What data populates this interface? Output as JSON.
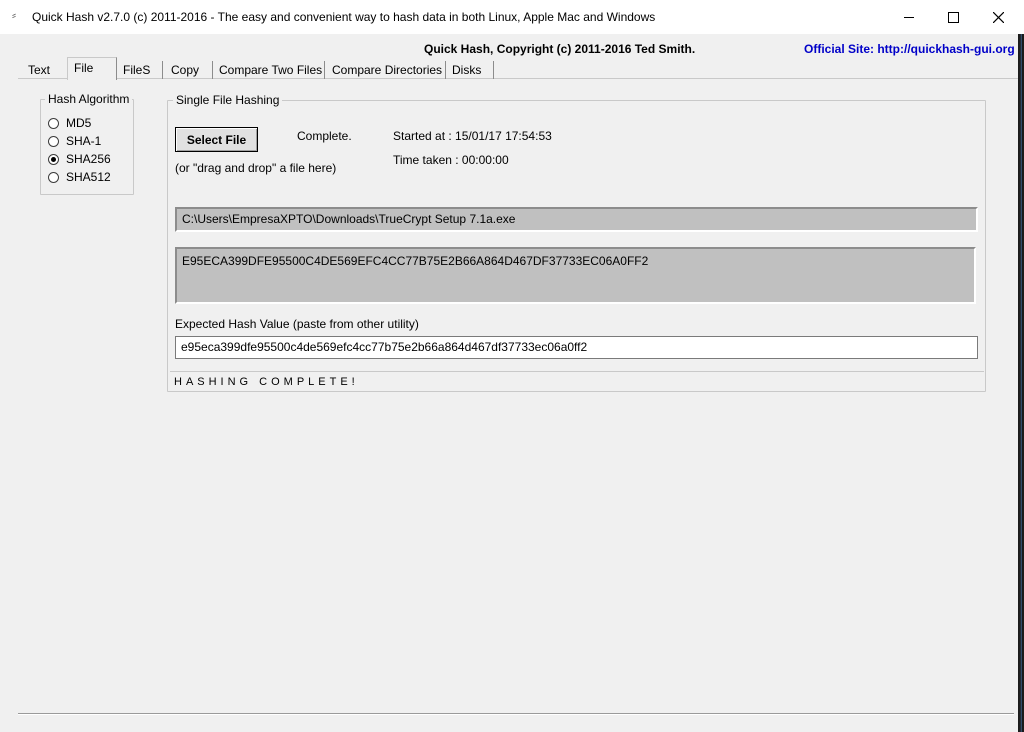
{
  "window": {
    "title": "Quick Hash v2.7.0 (c) 2011-2016 - The easy and convenient way to hash data in both Linux, Apple Mac and Windows",
    "controls": {
      "minimize": "minimize",
      "maximize": "maximize",
      "close": "close"
    }
  },
  "header": {
    "copyright": "Quick Hash, Copyright (c) 2011-2016  Ted Smith.",
    "site": "Official Site: http://quickhash-gui.org"
  },
  "tabs": [
    {
      "label": "Text"
    },
    {
      "label": "File"
    },
    {
      "label": "FileS"
    },
    {
      "label": "Copy"
    },
    {
      "label": "Compare Two Files"
    },
    {
      "label": "Compare Directories"
    },
    {
      "label": "Disks"
    }
  ],
  "active_tab": "File",
  "algorithm": {
    "title": "Hash Algorithm",
    "options": [
      {
        "label": "MD5",
        "checked": false
      },
      {
        "label": "SHA-1",
        "checked": false
      },
      {
        "label": "SHA256",
        "checked": true
      },
      {
        "label": "SHA512",
        "checked": false
      }
    ]
  },
  "single_file": {
    "title": "Single File Hashing",
    "select_button": "Select File",
    "status_word": "Complete.",
    "drag_hint": "(or \"drag and drop\" a file here)",
    "started_label": "Started at  : 15/01/17 17:54:53",
    "time_taken_label": "Time taken : 00:00:00",
    "file_path": "C:\\Users\\EmpresaXPTO\\Downloads\\TrueCrypt Setup 7.1a.exe",
    "hash_result": "E95ECA399DFE95500C4DE569EFC4CC77B75E2B66A864D467DF37733EC06A0FF2",
    "expected_label": "Expected Hash Value (paste from other utility)",
    "expected_value": "e95eca399dfe95500c4de569efc4cc77b75e2b66a864d467df37733ec06a0ff2",
    "status_bar": "HASHING COMPLETE!"
  },
  "colors": {
    "site_link": "#0000c8",
    "panel_bg": "#f0f0f0",
    "readonly_bg": "#c0c0c0"
  }
}
